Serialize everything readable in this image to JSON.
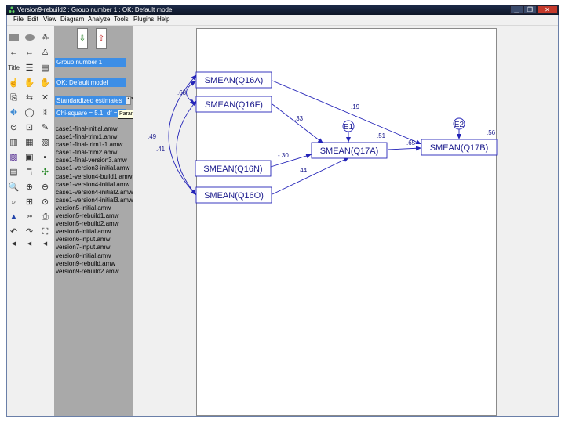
{
  "window": {
    "title": "Version9-rebuild2 : Group number 1 : OK: Default model",
    "controls": [
      "minimize-icon",
      "maximize-icon",
      "close-icon"
    ]
  },
  "menu": [
    "File",
    "Edit",
    "View",
    "Diagram",
    "Analyze",
    "Tools",
    "Plugins",
    "Help"
  ],
  "panel": {
    "group": "Group number 1",
    "model": "OK: Default model",
    "estimates": "Standardized estimates",
    "param_display": "Chi-square = 5.1, df =",
    "tooltip": "Parameter Formats",
    "files": [
      "case1-final-initial.amw",
      "case1-final-trim1.amw",
      "case1-final-trim1-1.amw",
      "case1-final-trim2.amw",
      "case1-final-version3.amw",
      "case1-version3-initial.amw",
      "case1-version4-build1.amw",
      "case1-version4-initial.amw",
      "case1-version4-initial2.amw",
      "case1-version4-initial3.amw",
      "version5-initial.amw",
      "version5-rebuild1.amw",
      "version5-rebuild2.amw",
      "version6-initial.amw",
      "version6-input.amw",
      "version7-input.amw",
      "version8-initial.amw",
      "version9-rebuild.amw",
      "version9-rebuild2.amw"
    ]
  },
  "diagram": {
    "nodes": {
      "q16a": "SMEAN(Q16A)",
      "q16f": "SMEAN(Q16F)",
      "q16n": "SMEAN(Q16N)",
      "q16o": "SMEAN(Q16O)",
      "q17a": "SMEAN(Q17A)",
      "q17b": "SMEAN(Q17B)",
      "e1": "E1",
      "e2": "E2"
    },
    "estimates": {
      "q16a_q17b": ".19",
      "q16f_q17a": ".33",
      "q16n_q17a": "-.30",
      "q16o_q17a": ".44",
      "q17a_q17b": ".65",
      "r2_q17a": ".51",
      "r2_q17b": ".56",
      "cov_a_f": ".68",
      "cov_a_o": ".49",
      "cov_f_o": ".41"
    },
    "line_color": "#2424b8"
  }
}
